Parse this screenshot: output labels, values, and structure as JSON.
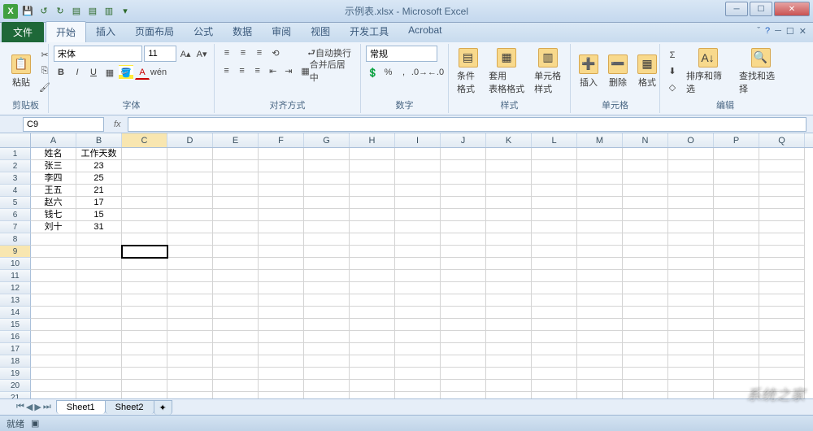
{
  "window": {
    "title": "示例表.xlsx - Microsoft Excel",
    "min": "─",
    "max": "☐",
    "close": "✕"
  },
  "qat": [
    "↺",
    "↻"
  ],
  "tabs": {
    "file": "文件",
    "items": [
      "开始",
      "插入",
      "页面布局",
      "公式",
      "数据",
      "审阅",
      "视图",
      "开发工具",
      "Acrobat"
    ],
    "activeIndex": 0
  },
  "ribbon": {
    "clipboard": {
      "title": "剪贴板",
      "paste": "粘贴"
    },
    "font": {
      "title": "字体",
      "name": "宋体",
      "size": "11",
      "bold": "B",
      "italic": "I",
      "underline": "U"
    },
    "align": {
      "title": "对齐方式",
      "wrap": "自动换行",
      "merge": "合并后居中"
    },
    "number": {
      "title": "数字",
      "format": "常规"
    },
    "styles": {
      "title": "样式",
      "cond": "条件格式",
      "table": "套用\n表格格式",
      "cellsty": "单元格样式"
    },
    "cells": {
      "title": "单元格",
      "insert": "插入",
      "delete": "删除",
      "format": "格式"
    },
    "editing": {
      "title": "编辑",
      "sort": "排序和筛选",
      "find": "查找和选择"
    }
  },
  "nameBox": "C9",
  "fx": "fx",
  "columns": [
    "A",
    "B",
    "C",
    "D",
    "E",
    "F",
    "G",
    "H",
    "I",
    "J",
    "K",
    "L",
    "M",
    "N",
    "O",
    "P",
    "Q"
  ],
  "activeCell": {
    "row": 9,
    "col": "C"
  },
  "data": {
    "A1": "姓名",
    "B1": "工作天数",
    "A2": "张三",
    "B2": "23",
    "A3": "李四",
    "B3": "25",
    "A4": "王五",
    "B4": "21",
    "A5": "赵六",
    "B5": "17",
    "A6": "钱七",
    "B6": "15",
    "A7": "刘十",
    "B7": "31"
  },
  "rowCount": 23,
  "sheets": [
    "Sheet1",
    "Sheet2"
  ],
  "activeSheet": 0,
  "status": "就绪",
  "watermark": "系统之家"
}
